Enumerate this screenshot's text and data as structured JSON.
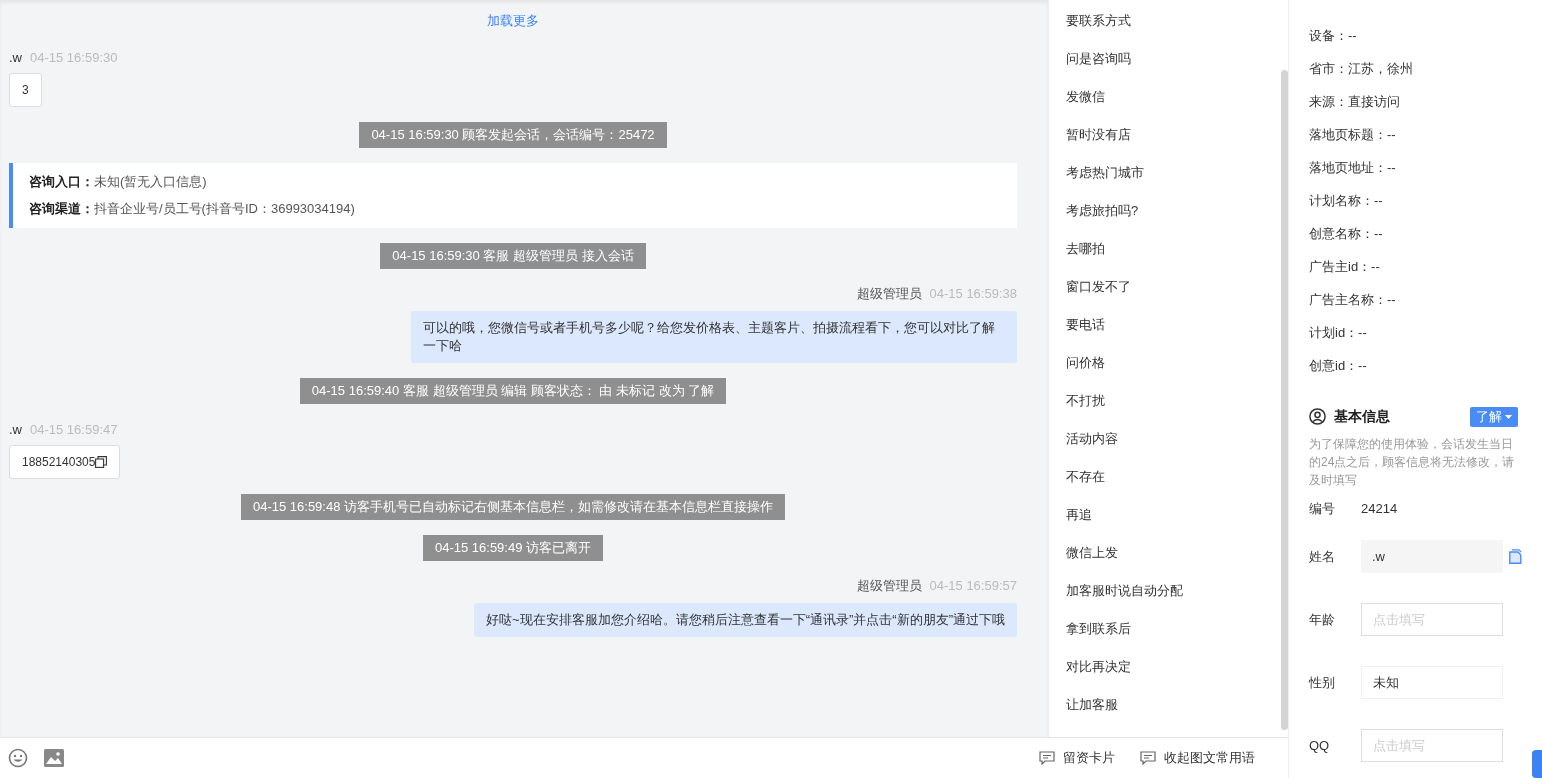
{
  "chat": {
    "load_more": "加载更多",
    "messages": [
      {
        "kind": "visitor",
        "sender": ".w",
        "time": "04-15 16:59:30",
        "text": "3",
        "copyable": false
      },
      {
        "kind": "system",
        "text": "04-15 16:59:30 顾客发起会话，会话编号：25472"
      },
      {
        "kind": "info",
        "lines": [
          {
            "label": "咨询入口：",
            "value": "未知(暂无入口信息)"
          },
          {
            "label": "咨询渠道：",
            "value": "抖音企业号/员工号(抖音号ID：36993034194)"
          }
        ]
      },
      {
        "kind": "system",
        "text": "04-15 16:59:30 客服 超级管理员 接入会话"
      },
      {
        "kind": "agent",
        "sender": "超级管理员",
        "time": "04-15 16:59:38",
        "text": "可以的哦，您微信号或者手机号多少呢？给您发价格表、主题客片、拍摄流程看下，您可以对比了解一下哈"
      },
      {
        "kind": "system",
        "text": "04-15 16:59:40 客服 超级管理员 编辑 顾客状态： 由 未标记 改为 了解"
      },
      {
        "kind": "visitor",
        "sender": ".w",
        "time": "04-15 16:59:47",
        "text": "18852140305",
        "copyable": true
      },
      {
        "kind": "system",
        "text": "04-15 16:59:48 访客手机号已自动标记右侧基本信息栏，如需修改请在基本信息栏直接操作"
      },
      {
        "kind": "system",
        "text": "04-15 16:59:49 访客已离开"
      },
      {
        "kind": "agent",
        "sender": "超级管理员",
        "time": "04-15 16:59:57",
        "text": "好哒~现在安排客服加您介绍哈。请您稍后注意查看一下“通讯录”并点击“新的朋友”通过下哦"
      }
    ]
  },
  "quick_replies": [
    "要联系方式",
    "问是咨询吗",
    "发微信",
    "暂时没有店",
    "考虑热门城市",
    "考虑旅拍吗?",
    "去哪拍",
    "窗口发不了",
    "要电话",
    "问价格",
    "不打扰",
    "活动内容",
    "不存在",
    "再追",
    "微信上发",
    "加客服时说自动分配",
    "拿到联系后",
    "对比再决定",
    "让加客服"
  ],
  "toolbar": {
    "buttons": [
      "留资卡片",
      "收起图文常用语"
    ]
  },
  "source_info": [
    "设备：--",
    "省市：江苏，徐州",
    "来源：直接访问",
    "落地页标题：--",
    "落地页地址：--",
    "计划名称：--",
    "创意名称：--",
    "广告主id：--",
    "广告主名称：--",
    "计划id：--",
    "创意id：--"
  ],
  "basic_info": {
    "title": "基本信息",
    "status": "了解",
    "notice": "为了保障您的使用体验，会话发生当日的24点之后，顾客信息将无法修改，请及时填写",
    "fields": [
      {
        "kind": "text",
        "label": "编号",
        "value": "24214"
      },
      {
        "kind": "readonly",
        "label": "姓名",
        "value": ".w"
      },
      {
        "kind": "input",
        "label": "年龄",
        "placeholder": "点击填写"
      },
      {
        "kind": "select",
        "label": "性别",
        "value": "未知"
      },
      {
        "kind": "input",
        "label": "QQ",
        "placeholder": "点击填写"
      }
    ]
  }
}
